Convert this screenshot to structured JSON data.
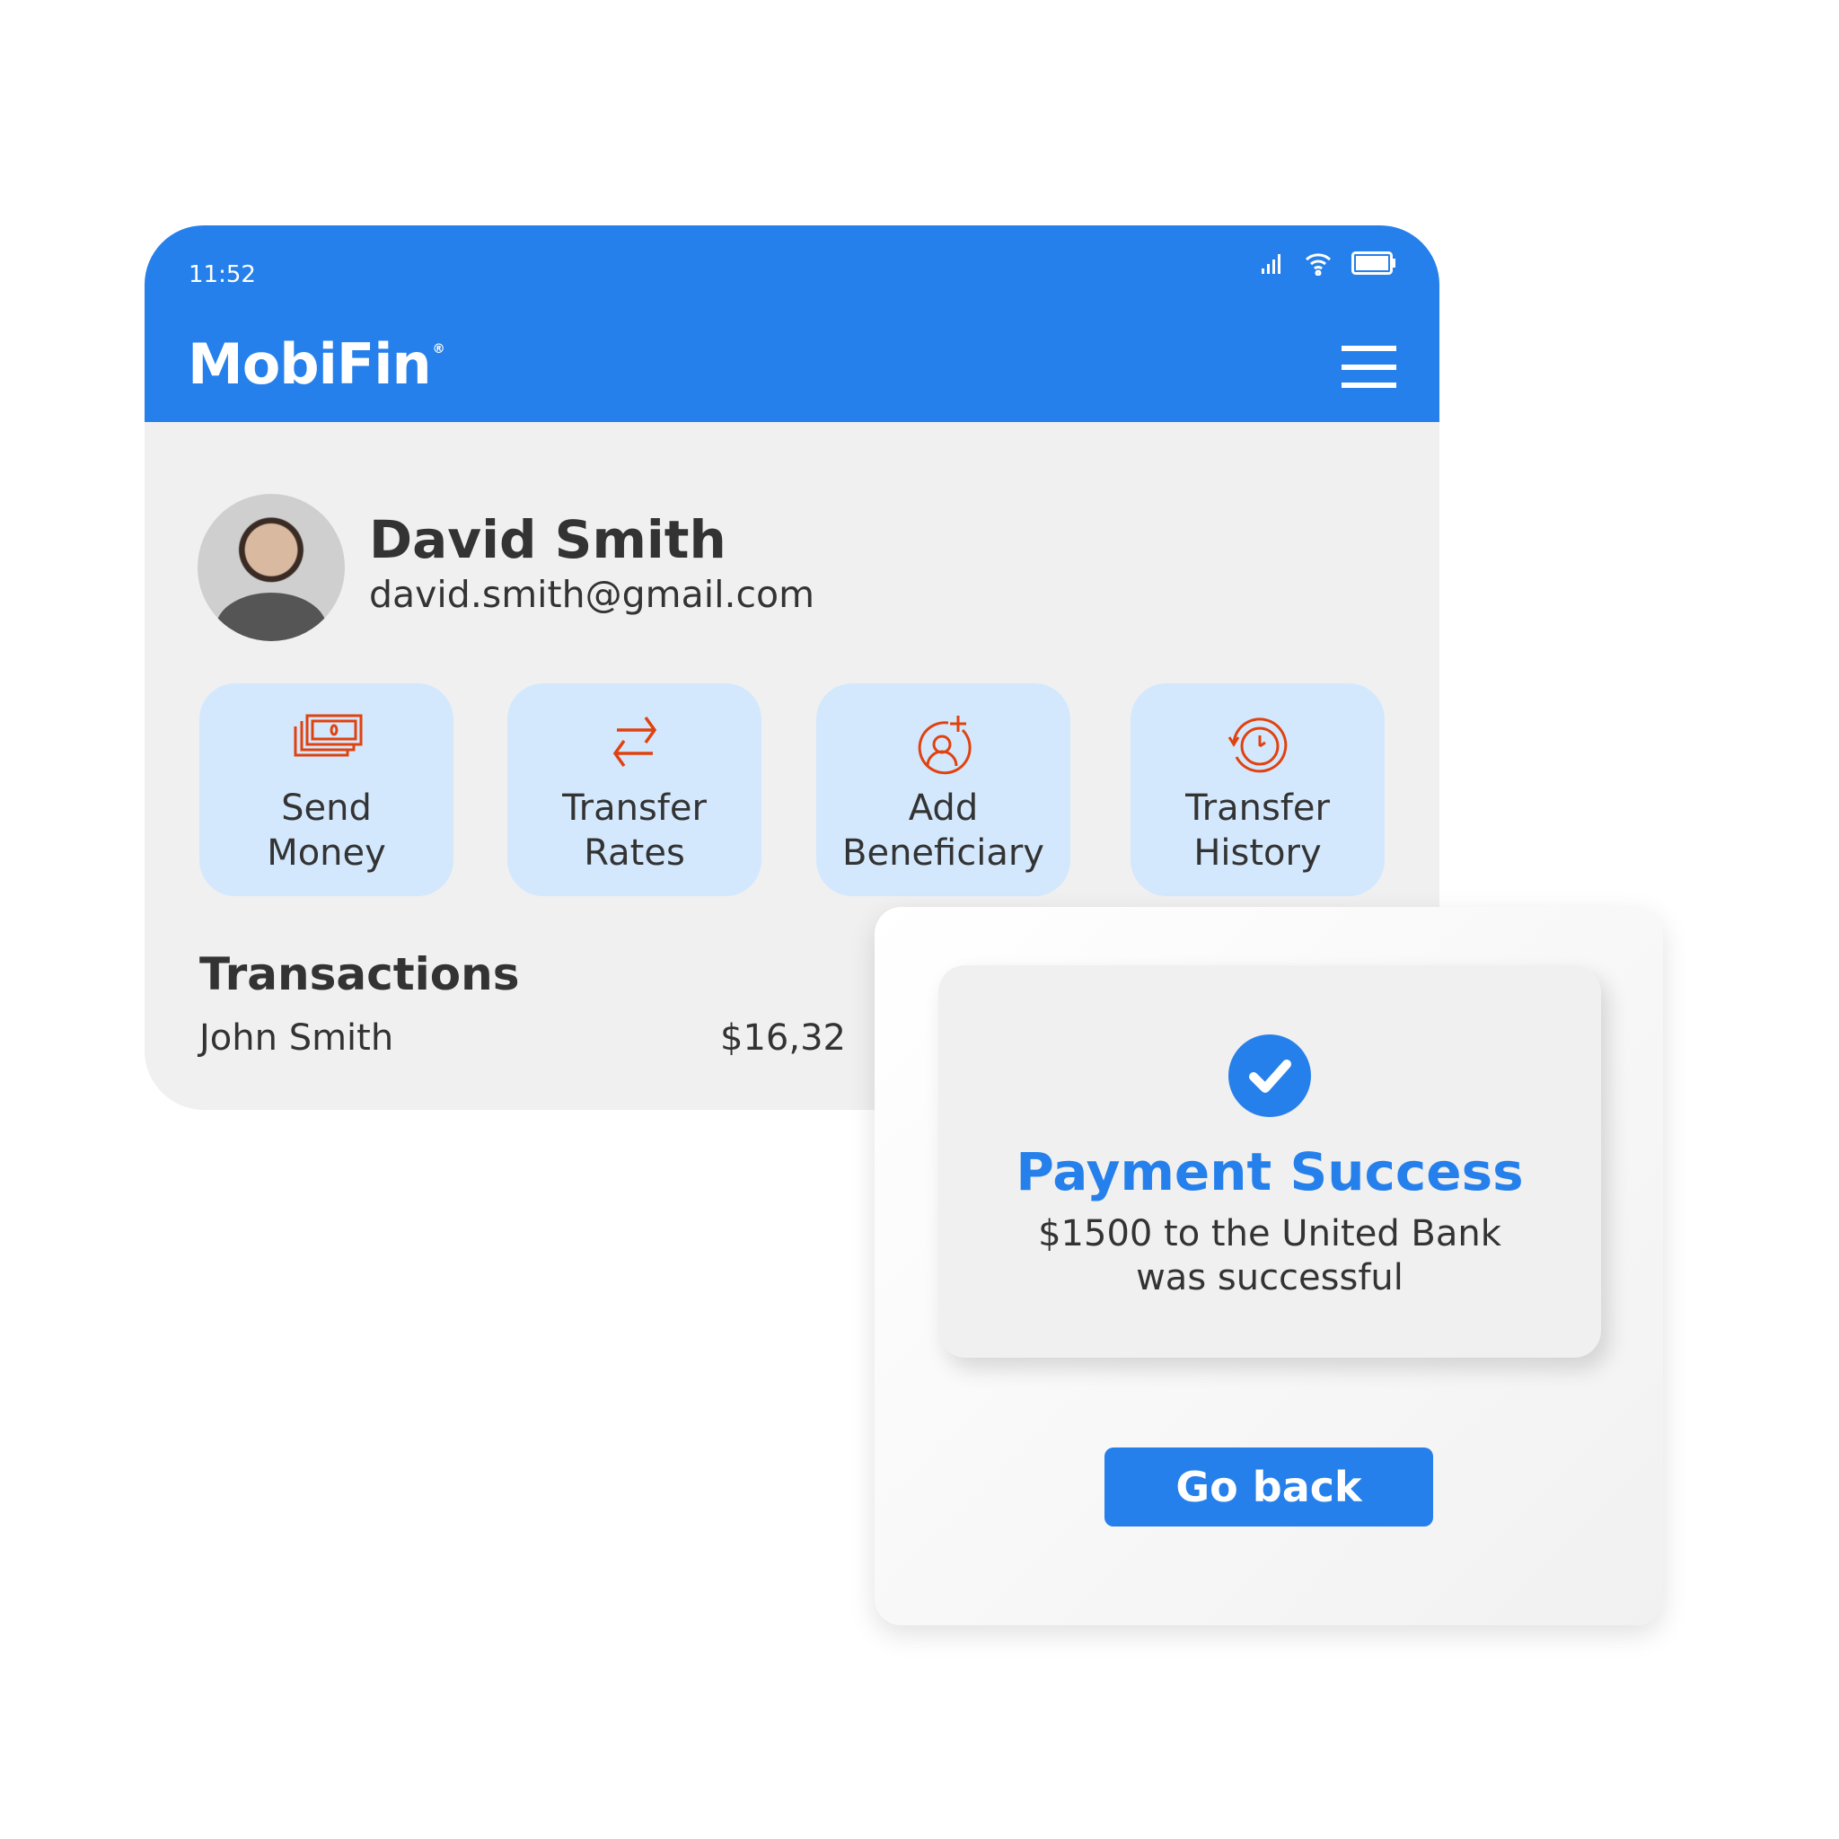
{
  "status_bar": {
    "time": "11:52",
    "icons": [
      "signal-icon",
      "wifi-icon",
      "battery-icon"
    ]
  },
  "header": {
    "logo": "MobiFin",
    "logo_mark": "®",
    "menu_icon": "hamburger-icon"
  },
  "profile": {
    "name": "David Smith",
    "email": "david.smith@gmail.com"
  },
  "actions": [
    {
      "line1": "Send",
      "line2": "Money",
      "icon": "cash-icon"
    },
    {
      "line1": "Transfer",
      "line2": "Rates",
      "icon": "arrows-swap-icon"
    },
    {
      "line1": "Add",
      "line2": "Beneficiary",
      "icon": "add-user-icon"
    },
    {
      "line1": "Transfer",
      "line2": "History",
      "icon": "clock-history-icon"
    }
  ],
  "transactions": {
    "title": "Transactions",
    "items": [
      {
        "name": "John Smith",
        "amount": "$16,32"
      }
    ]
  },
  "modal": {
    "title": "Payment Success",
    "line1": "$1500 to the United Bank",
    "line2": "was successful",
    "button": "Go back"
  },
  "colors": {
    "brand": "#2680eb",
    "icon": "#e0420f",
    "tile": "#d3e8fd"
  }
}
